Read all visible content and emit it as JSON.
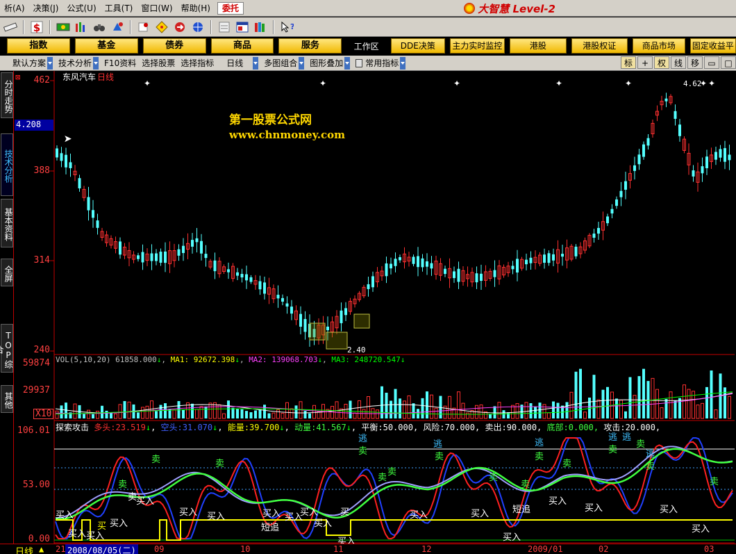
{
  "menu": {
    "items": [
      "析(A)",
      "决策(J)",
      "公式(U)",
      "工具(T)",
      "窗口(W)",
      "帮助(H)"
    ],
    "entrust": "委托",
    "brand": "大智慧 Level-2"
  },
  "toolbar": {
    "icons": [
      "ruler-icon",
      "dollar-icon",
      "flag-icon",
      "chart-bars-icon",
      "binoculars-icon",
      "alarm-icon",
      "pushpin-icon",
      "diamond-icon",
      "circle-arrows-icon",
      "globe-icon",
      "notepad-icon",
      "window-icon",
      "books-icon",
      "help-pointer-icon"
    ]
  },
  "nav": {
    "buttons": [
      "指数",
      "基金",
      "债券",
      "商品",
      "服务"
    ],
    "workspace": "工作区",
    "tabs": [
      "DDE决策",
      "主力实时监控",
      "港股",
      "港股权证",
      "商品市场",
      "固定收益平"
    ]
  },
  "subbar": {
    "items": [
      "默认方案",
      "技术分析",
      "F10资料",
      "选择股票",
      "选择指标",
      "日线",
      "多图组合",
      "图形叠加",
      "常用指标"
    ],
    "right_buttons": [
      "标",
      "+",
      "权",
      "线",
      "移",
      "▭",
      "□"
    ]
  },
  "left_tabs": [
    "分时走势",
    "技术分析",
    "基本资料",
    "全屏",
    "TOP综合",
    "其他"
  ],
  "price_panel": {
    "stock_name": "东风汽车",
    "period": "日线",
    "watermark_title": "第一股票公式网",
    "watermark_url": "www.chnmoney.com",
    "y_ticks": [
      "462",
      "388",
      "314",
      "240"
    ],
    "current_value": "4.208",
    "high_label": "4.62",
    "low_label": "2.40"
  },
  "volume_panel": {
    "header_name": "VOL(5,10,20)",
    "header_value": "61858.000",
    "ma1_label": "MA1: 92672.398",
    "ma2_label": "MA2: 139068.703",
    "ma3_label": "MA3: 248720.547",
    "y_ticks": [
      "59874",
      "29937"
    ],
    "unit": "X10"
  },
  "indicator_panel": {
    "name": "探索攻击",
    "fields": [
      {
        "label": "多头:",
        "value": "23.519"
      },
      {
        "label": "空头:",
        "value": "31.070"
      },
      {
        "label": "能量:",
        "value": "39.700"
      },
      {
        "label": "动量:",
        "value": "41.567"
      },
      {
        "label": "平衡:",
        "value": "50.000,"
      },
      {
        "label": "风险:",
        "value": "70.000,"
      },
      {
        "label": "卖出:",
        "value": "90.000,"
      },
      {
        "label": "底部:",
        "value": "0.000,"
      },
      {
        "label": "攻击:",
        "value": "20.000,"
      }
    ],
    "y_ticks": [
      "106.01",
      "53.00",
      "0.00"
    ],
    "signal_buy": "买入",
    "signal_sell": "卖",
    "signal_escape": "逃",
    "signal_chase": "短追",
    "signal_buy_short": "买"
  },
  "date_axis": {
    "period_label": "日线",
    "ticks": [
      "21",
      "2008/08/05(二)",
      "09",
      "10",
      "11",
      "12",
      "2009/01",
      "02",
      "03"
    ]
  },
  "colors": {
    "up": "#ff3030",
    "down": "#54ffff",
    "grid": "#c00000",
    "ma1": "#ffffff",
    "ma2": "#ff40ff",
    "ma3": "#00ff00",
    "long": "#ff2020",
    "short": "#2040ff",
    "energy": "#40ff40",
    "momentum": "#a0a0ff",
    "bottom_line": "#ffff00"
  }
}
